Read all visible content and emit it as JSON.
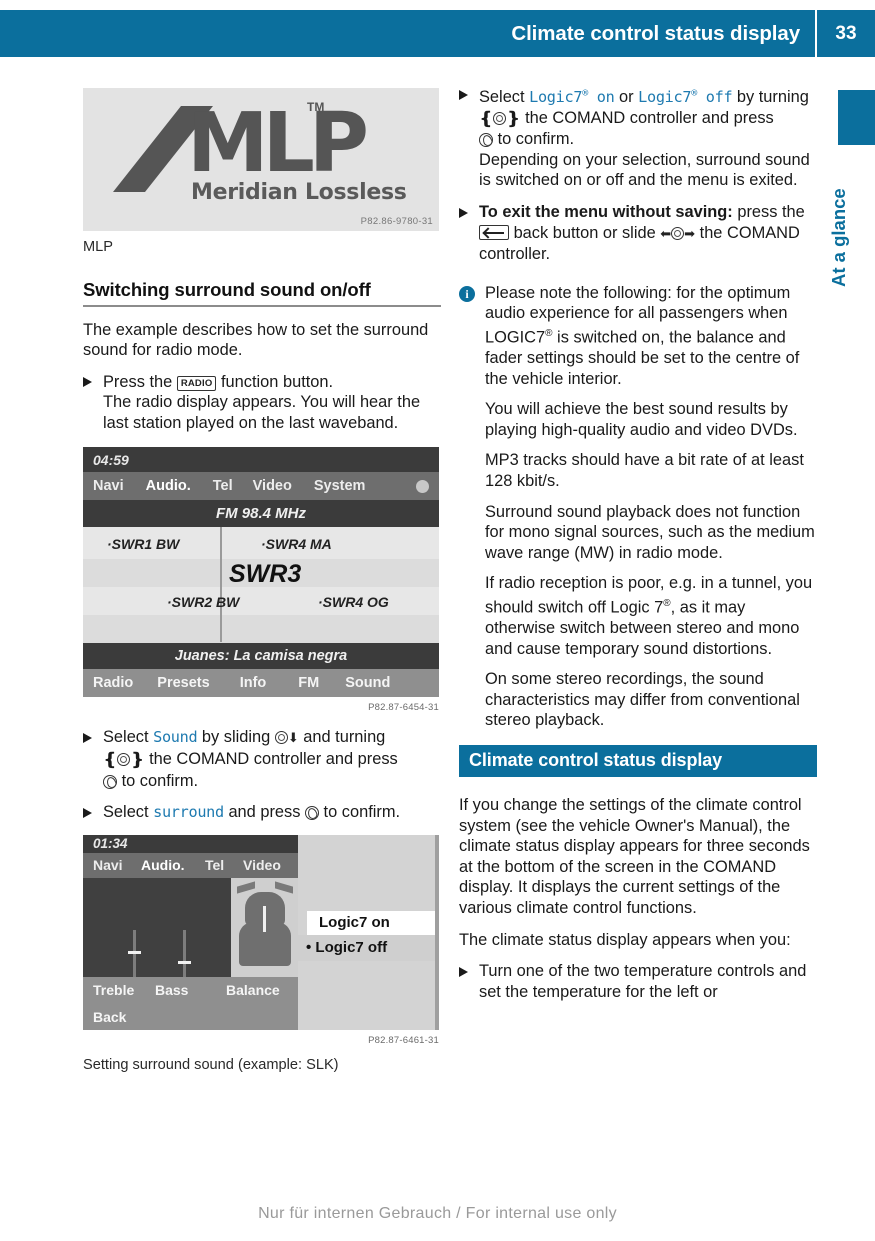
{
  "header": {
    "title": "Climate control status display",
    "page_number": "33",
    "accent_color": "#0b6f9d"
  },
  "side_tab": {
    "label": "At a glance"
  },
  "left_column": {
    "figure_mlp": {
      "logo_letters": "MLP",
      "trademark": "TM",
      "subtitle": "Meridian Lossless",
      "code": "P82.86-9780-31"
    },
    "caption_mlp": "MLP",
    "subheading": "Switching surround sound on/off",
    "intro": "The example describes how to set the surround sound for radio mode.",
    "bullet_radio_button": {
      "lead": "Press the",
      "key": "RADIO",
      "tail": "function button.",
      "sub": "The radio display appears. You will hear the last station played on the last waveband."
    },
    "figure_radio": {
      "time": "04:59",
      "menu": [
        "Navi",
        "Audio.",
        "Tel",
        "Video",
        "System"
      ],
      "frequency": "FM 98.4 MHz",
      "presets": [
        "·SWR1 BW",
        "·SWR4 MA",
        "·SWR2 BW",
        "·SWR4 OG"
      ],
      "current_station": "SWR3",
      "track": "Juanes: La camisa negra",
      "softkeys": [
        "Radio",
        "Presets",
        "Info",
        "FM",
        "Sound"
      ],
      "code": "P82.87-6454-31"
    },
    "bullet_select_sound": {
      "p1": "Select",
      "menu_item": "Sound",
      "p2": "by sliding",
      "p3": "and turning",
      "p4": "the COMAND controller and press",
      "p5": "to confirm."
    },
    "bullet_select_surround": {
      "p1": "Select",
      "menu_item": "surround",
      "p2": "and press",
      "p3": "to confirm."
    },
    "figure_sound": {
      "time": "01:34",
      "menu": [
        "Navi",
        "Audio.",
        "Tel",
        "Video"
      ],
      "labels": [
        "Treble",
        "Bass",
        "Balance"
      ],
      "back": "Back",
      "option_on": "Logic7 on",
      "option_off": "Logic7 off",
      "code": "P82.87-6461-31"
    },
    "caption_sound": "Setting surround sound (example: SLK)"
  },
  "right_column": {
    "bullet_logic7": {
      "p1": "Select",
      "menu_on": "Logic7",
      "menu_on_suffix": "on",
      "p2": "or",
      "menu_off": "Logic7",
      "menu_off_suffix": "off",
      "p3": "by turning",
      "p4": "the COMAND controller and press",
      "p5": "to confirm.",
      "sub": "Depending on your selection, surround sound is switched on or off and the menu is exited."
    },
    "bullet_exit": {
      "bold": "To exit the menu without saving:",
      "p1": "press the",
      "p2": "back button or slide",
      "p3": "the COMAND controller."
    },
    "note": {
      "icon": "i",
      "paragraphs": [
        "Please note the following: for the optimum audio experience for all passengers when LOGIC7® is switched on, the balance and fader settings should be set to the centre of the vehicle interior.",
        "You will achieve the best sound results by playing high-quality audio and video DVDs.",
        "MP3 tracks should have a bit rate of at least 128 kbit/s.",
        "Surround sound playback does not function for mono signal sources, such as the medium wave range (MW) in radio mode.",
        "If radio reception is poor, e.g. in a tunnel, you should switch off Logic 7®, as it may otherwise switch between stereo and mono and cause temporary sound distortions.",
        "On some stereo recordings, the sound characteristics may differ from conventional stereo playback."
      ]
    },
    "section_heading": "Climate control status display",
    "body1": "If you change the settings of the climate control system (see the vehicle Owner's Manual), the climate status display appears for three seconds at the bottom of the screen in the COMAND display. It displays the current settings of the various climate control functions.",
    "body2": "The climate status display appears when you:",
    "bullet_temp": "Turn one of the two temperature controls and set the temperature for the left or"
  },
  "footer": {
    "text": "Nur für internen Gebrauch / For internal use only"
  }
}
